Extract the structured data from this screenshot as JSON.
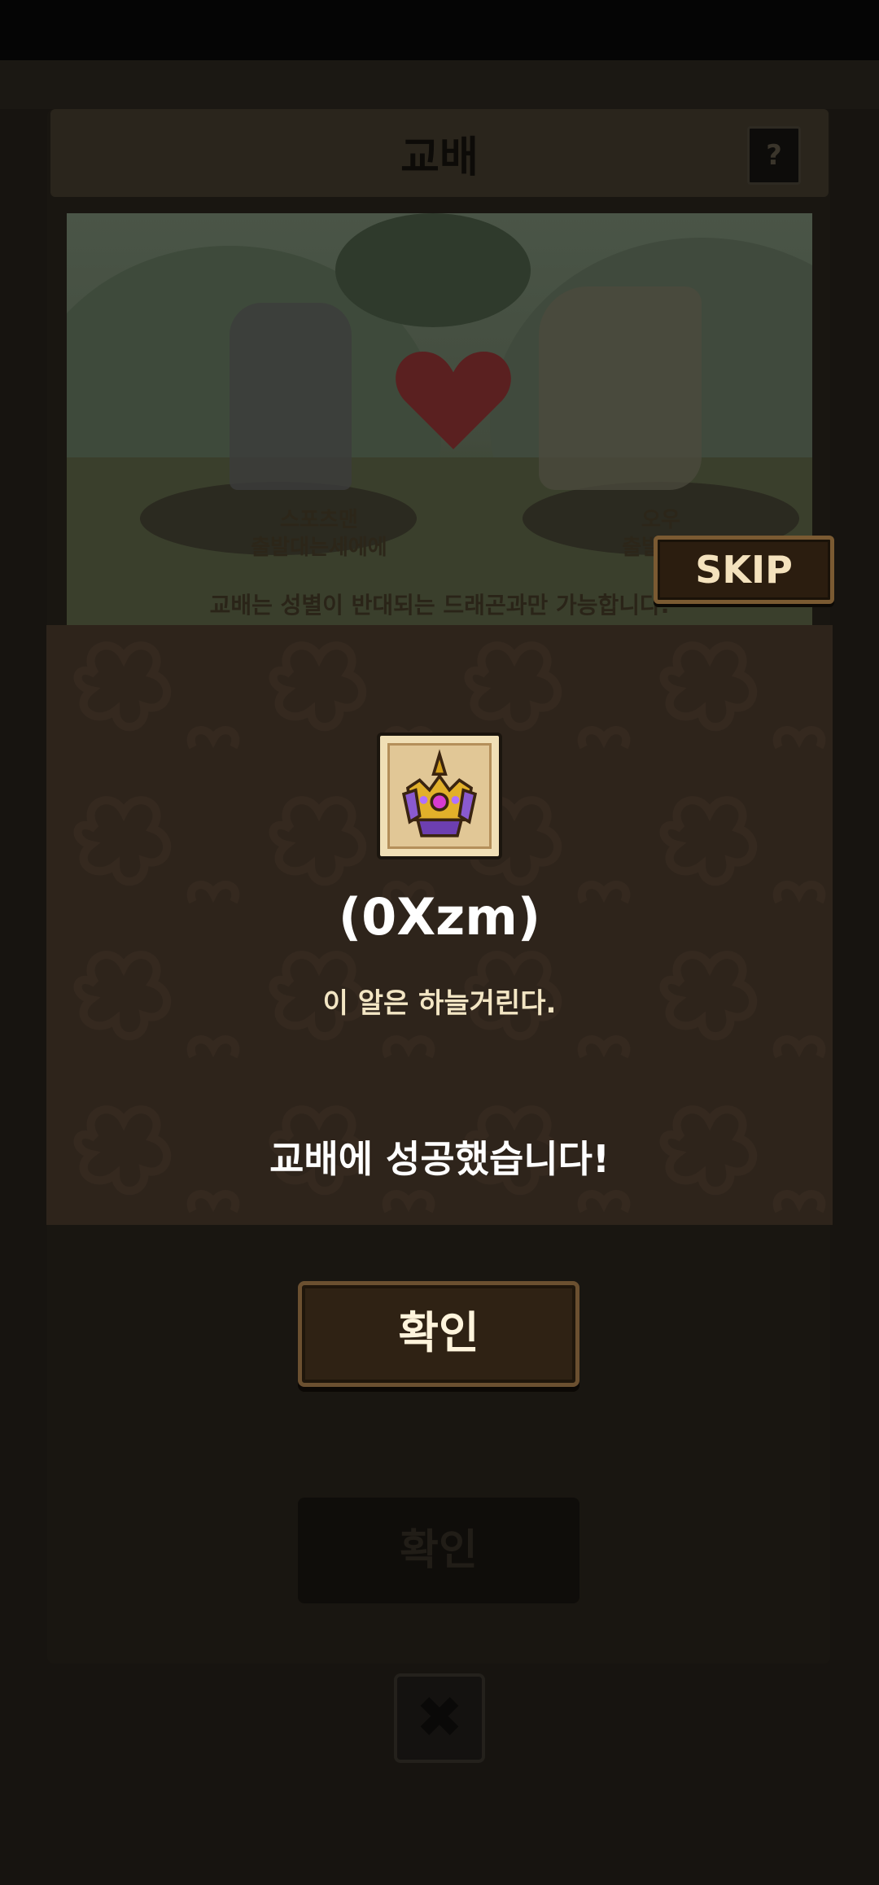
{
  "modal": {
    "title": "교배",
    "help_label": "?",
    "left_dragon": {
      "name": "스포츠맨",
      "role": "출발대는세에에"
    },
    "right_dragon": {
      "name": "오우",
      "role": "출발대는"
    },
    "notice": "교배는 성별이 반대되는 드래곤과만 가능합니다.",
    "confirm_label": "확인"
  },
  "skip_button": {
    "label": "SKIP"
  },
  "result": {
    "item_icon": "egg-crown-icon",
    "item_name": "(0Xzm)",
    "description": "이 알은 하늘거린다.",
    "success_message": "교배에 성공했습니다!",
    "confirm_label": "확인"
  },
  "close_button": {
    "icon": "close-x-icon",
    "label": "✖"
  },
  "colors": {
    "popup_bg": "#2e241b",
    "button_bg": "#2f2214",
    "button_border": "#6b5030",
    "text_light": "#f3e6c4"
  }
}
